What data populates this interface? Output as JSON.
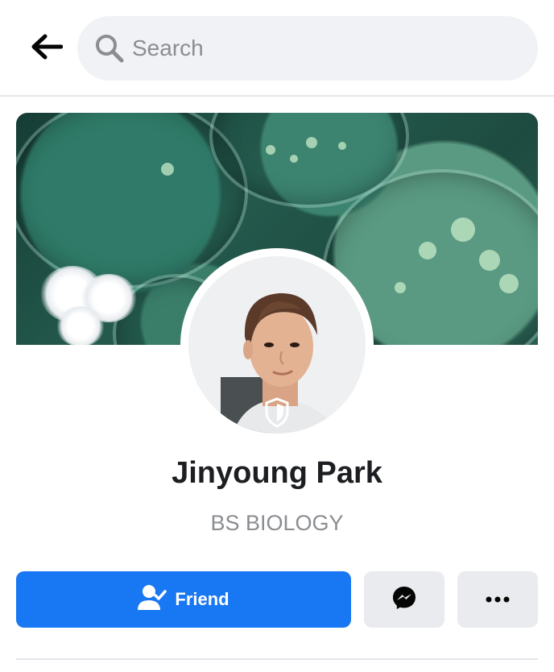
{
  "search": {
    "placeholder": "Search"
  },
  "profile": {
    "name": "Jinyoung Park",
    "subtitle": "BS BIOLOGY"
  },
  "actions": {
    "friend_label": "Friend"
  },
  "icons": {
    "back": "arrow-left-icon",
    "search": "search-icon",
    "shield": "shield-icon",
    "friend": "friend-check-icon",
    "messenger": "messenger-icon",
    "more": "more-dots-icon"
  },
  "colors": {
    "primary": "#1877f2",
    "button_secondary": "#e9ebee",
    "search_bg": "#f0f2f5",
    "text_primary": "#1c1e21",
    "text_secondary": "#8a8d91"
  }
}
